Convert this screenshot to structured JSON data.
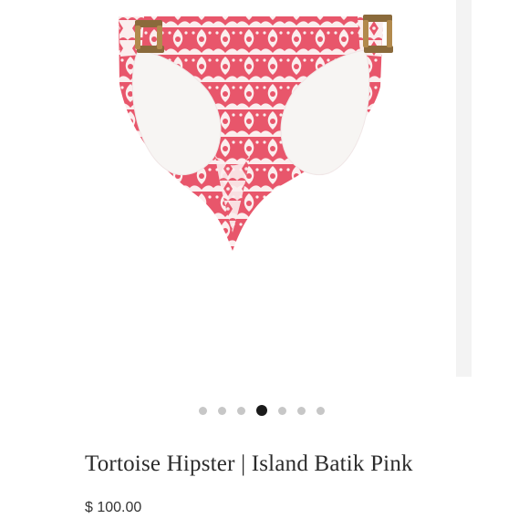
{
  "product": {
    "title": "Tortoise Hipster | Island Batik Pink",
    "price": "$ 100.00",
    "image_icon": "bikini-bottom-photo",
    "colors": {
      "pattern_pink": "#e8566b",
      "pattern_cream": "#fbeeee",
      "lining": "#f7f5f3",
      "tortoise": "#8a6a3b"
    }
  },
  "carousel": {
    "slide_count": 7,
    "active_index": 3
  }
}
